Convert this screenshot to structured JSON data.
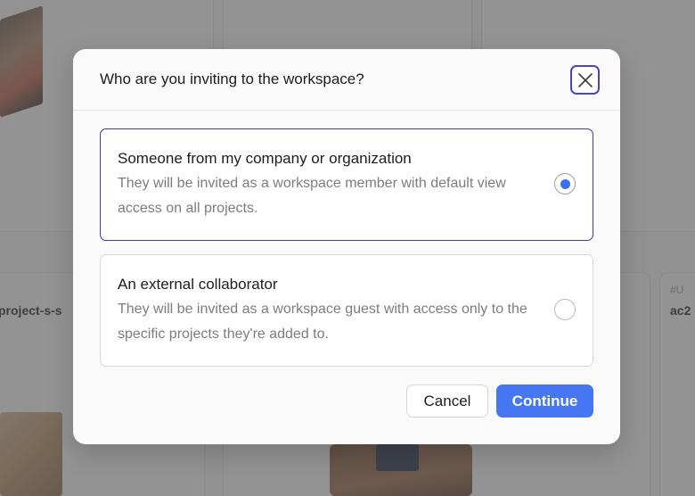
{
  "background": {
    "card_left_label": "project-s-s",
    "card_right_label": "ac2",
    "card_right_meta": "#U"
  },
  "modal": {
    "title": "Who are you inviting to the workspace?",
    "close_icon": "close-icon",
    "options": [
      {
        "title": "Someone from my company or organization",
        "description": "They will be invited as a workspace member with default view access on all projects.",
        "selected": true
      },
      {
        "title": "An external collaborator",
        "description": "They will be invited as a workspace guest with access only to the specific projects they're added to.",
        "selected": false
      }
    ],
    "cancel_label": "Cancel",
    "continue_label": "Continue"
  },
  "colors": {
    "accent": "#4676f2",
    "selected_border": "#3e3ab0",
    "radio_dot": "#3a6ef5",
    "close_border": "#4a45c8"
  }
}
